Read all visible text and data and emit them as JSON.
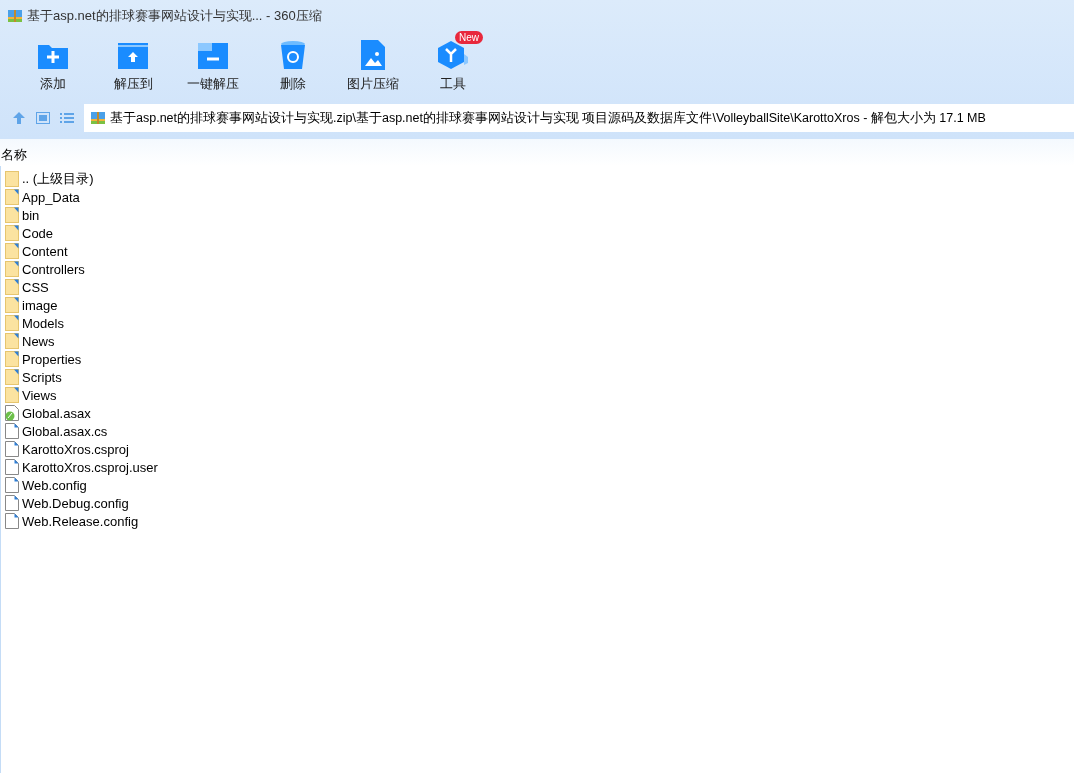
{
  "window": {
    "title": "基于asp.net的排球赛事网站设计与实现... - 360压缩"
  },
  "toolbar": [
    {
      "kind": "add",
      "label": "添加"
    },
    {
      "kind": "extract",
      "label": "解压到"
    },
    {
      "kind": "oneclick",
      "label": "一键解压"
    },
    {
      "kind": "delete",
      "label": "删除"
    },
    {
      "kind": "image",
      "label": "图片压缩"
    },
    {
      "kind": "tools",
      "label": "工具",
      "badge": "New"
    }
  ],
  "address": {
    "path": "基于asp.net的排球赛事网站设计与实现.zip\\基于asp.net的排球赛事网站设计与实现 项目源码及数据库文件\\VolleyballSite\\KarottoXros - 解包大小为 17.1 MB"
  },
  "list": {
    "columns": [
      "名称"
    ],
    "rows": [
      {
        "kind": "parent",
        "name": ".. (上级目录)"
      },
      {
        "kind": "folder",
        "name": "App_Data"
      },
      {
        "kind": "folder",
        "name": "bin"
      },
      {
        "kind": "folder",
        "name": "Code"
      },
      {
        "kind": "folder",
        "name": "Content"
      },
      {
        "kind": "folder",
        "name": "Controllers"
      },
      {
        "kind": "folder",
        "name": "CSS"
      },
      {
        "kind": "folder",
        "name": "image"
      },
      {
        "kind": "folder",
        "name": "Models"
      },
      {
        "kind": "folder",
        "name": "News"
      },
      {
        "kind": "folder",
        "name": "Properties"
      },
      {
        "kind": "folder",
        "name": "Scripts"
      },
      {
        "kind": "folder",
        "name": "Views"
      },
      {
        "kind": "asax",
        "name": "Global.asax"
      },
      {
        "kind": "file",
        "name": "Global.asax.cs"
      },
      {
        "kind": "file",
        "name": "KarottoXros.csproj"
      },
      {
        "kind": "file",
        "name": "KarottoXros.csproj.user"
      },
      {
        "kind": "file",
        "name": "Web.config"
      },
      {
        "kind": "file",
        "name": "Web.Debug.config"
      },
      {
        "kind": "file",
        "name": "Web.Release.config"
      }
    ]
  }
}
